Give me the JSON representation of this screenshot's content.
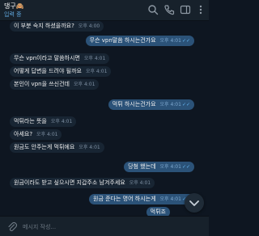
{
  "header": {
    "contact_name": "댕구🙈",
    "status": "입력 중"
  },
  "messages": [
    {
      "dir": "in",
      "text": "이 부분 숙지 하셨을까요?",
      "time": "오후 4:00"
    },
    {
      "dir": "out",
      "text": "무슨 vpn말씀 하시는건가요",
      "time": "오후 4:01"
    },
    {
      "dir": "in",
      "text": "무슨 vpn이라고 말씀하시면",
      "time": "오후 4:01"
    },
    {
      "dir": "in",
      "text": "어떻게 답변을 드려야 될까요",
      "time": "오후 4:01"
    },
    {
      "dir": "in",
      "text": "본인이 vpn을 쓰신건데",
      "time": "오후 4:01"
    },
    {
      "dir": "out",
      "text": "먹튀 하시는건가요",
      "time": "오후 4:01"
    },
    {
      "dir": "in",
      "text": "먹튀라는 뜻을",
      "time": "오후 4:01"
    },
    {
      "dir": "in",
      "text": "아세요?",
      "time": "오후 4:01"
    },
    {
      "dir": "in",
      "text": "원금도 안주는게 먹튀에요",
      "time": "오후 4:01"
    },
    {
      "dir": "out",
      "text": "당첨 했는데",
      "time": "오후 4:01"
    },
    {
      "dir": "in",
      "text": "원금이라도 받고 싶으시면 지갑주소 남겨주세요",
      "time": "오후 4:01"
    },
    {
      "dir": "out",
      "text": "원금 준다는 명어 하시는게",
      "time": "오후 4:01"
    },
    {
      "dir": "out",
      "text": "먹튀죠",
      "time": ""
    }
  ],
  "composer": {
    "placeholder": "메시지 작성..."
  },
  "colors": {
    "background": "#0e1621",
    "header": "#17212b",
    "incoming_bubble": "#182533",
    "outgoing_bubble": "#2b5278",
    "accent": "#64b5ef"
  }
}
